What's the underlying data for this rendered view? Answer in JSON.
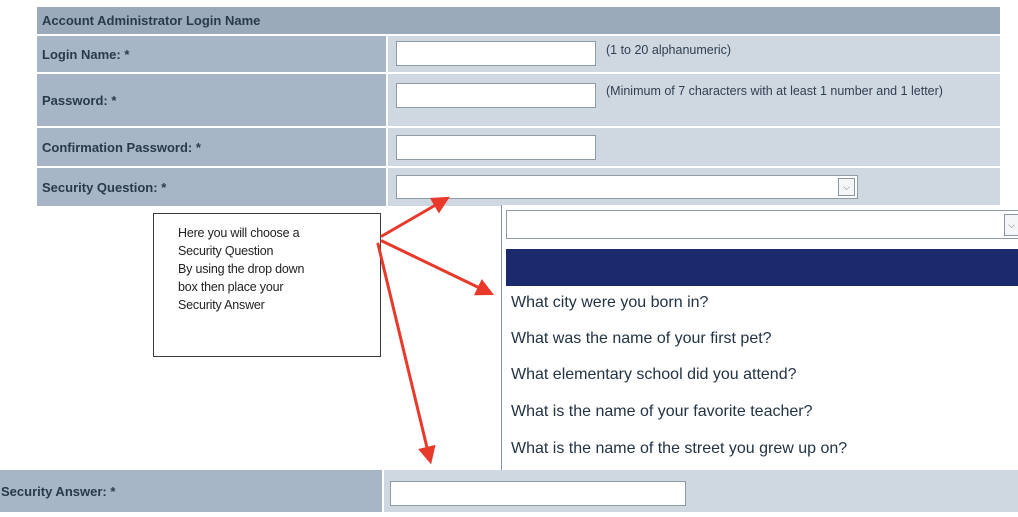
{
  "form": {
    "section_header": "Account Administrator Login Name",
    "login_name_label": "Login Name: *",
    "login_name_hint": "(1 to 20 alphanumeric)",
    "password_label": "Password: *",
    "password_hint": "(Minimum of 7 characters with at least 1 number and 1 letter)",
    "confirm_password_label": "Confirmation Password: *",
    "security_question_label": "Security Question: *",
    "security_answer_label": "Security Answer: *",
    "login_name_value": "",
    "password_value": "",
    "confirm_password_value": "",
    "security_question_value": "",
    "security_answer_value": ""
  },
  "callout": {
    "text": "Here you will choose a\nSecurity Question\nBy using the drop down\nbox then place your\nSecurity Answer"
  },
  "dropdown": {
    "selected": "",
    "options": [
      "",
      "What city were you born in?",
      "What was the name of your first pet?",
      "What elementary school did you attend?",
      "What is the name of your favorite teacher?",
      "What is the name of the street you grew up on?"
    ]
  },
  "icons": {
    "dropdown_arrow": "chevron-down-icon",
    "annotation_arrow": "red-arrow-icon"
  },
  "colors": {
    "header_bg": "#9aaabb",
    "label_bg": "#a7b6c6",
    "field_bg": "#cfd8e1",
    "highlight": "#1a2a6c",
    "arrow": "#e8392a"
  }
}
